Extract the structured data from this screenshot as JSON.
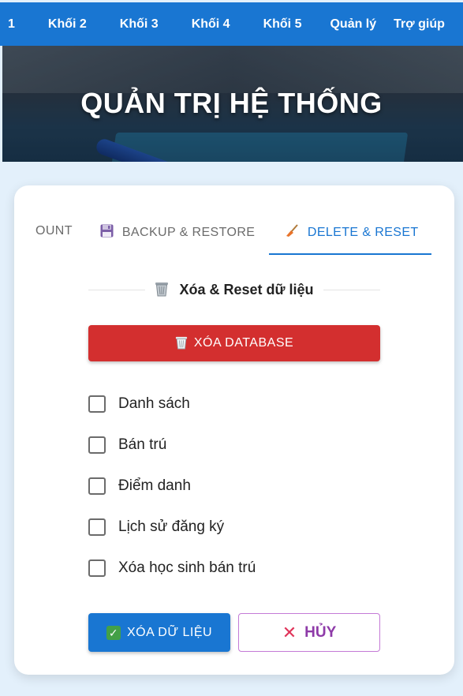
{
  "nav": {
    "items": [
      "1",
      "Khối 2",
      "Khối 3",
      "Khối 4",
      "Khối 5",
      "Quản lý",
      "Trợ giúp"
    ]
  },
  "hero": {
    "title": "QUẢN TRỊ HỆ THỐNG"
  },
  "tabs": [
    {
      "label": "OUNT",
      "icon": "none",
      "active": false
    },
    {
      "label": "BACKUP & RESTORE",
      "icon": "floppy-disk-icon",
      "active": false
    },
    {
      "label": "DELETE & RESET",
      "icon": "broom-icon",
      "active": true
    }
  ],
  "section": {
    "title": "Xóa & Reset dữ liệu",
    "icon": "wastebasket-icon"
  },
  "delete_db_button": {
    "label": "XÓA DATABASE",
    "icon": "wastebasket-icon"
  },
  "checkboxes": [
    {
      "label": "Danh sách",
      "checked": false
    },
    {
      "label": "Bán trú",
      "checked": false
    },
    {
      "label": "Điểm danh",
      "checked": false
    },
    {
      "label": "Lịch sử đăng ký",
      "checked": false
    },
    {
      "label": "Xóa học sinh bán trú",
      "checked": false
    }
  ],
  "actions": {
    "confirm_label": "XÓA DỮ LIỆU",
    "confirm_icon": "check-mark-icon",
    "cancel_label": "HỦY",
    "cancel_icon": "cross-icon"
  },
  "colors": {
    "primary": "#1976d2",
    "danger": "#d32f2f",
    "cancel_text": "#8e3aa8",
    "page_bg": "#e3f0fb"
  }
}
